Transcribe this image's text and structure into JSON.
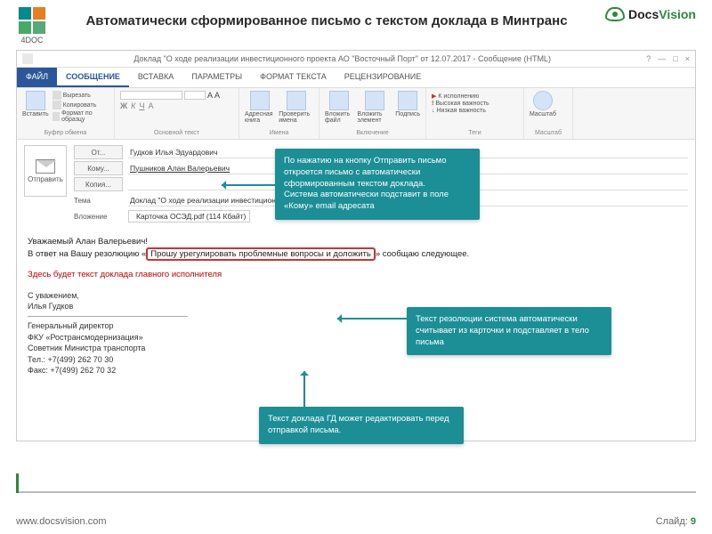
{
  "slide": {
    "title": "Автоматически сформированное письмо с текстом доклада в Минтранс",
    "logo4doc": "4DOC",
    "docsvision": "DocsVision",
    "footer_url": "www.docsvision.com",
    "footer_slide_label": "Слайд:",
    "footer_slide_num": "9"
  },
  "window": {
    "title": "Доклад \"О ходе реализации инвестиционного проекта АО \"Восточный Порт\" от 12.07.2017 - Сообщение (HTML)",
    "help": "?",
    "min": "—",
    "max": "□",
    "close": "×"
  },
  "tabs": {
    "file": "ФАЙЛ",
    "message": "СООБЩЕНИЕ",
    "insert": "ВСТАВКА",
    "options": "ПАРАМЕТРЫ",
    "format": "ФОРМАТ ТЕКСТА",
    "review": "РЕЦЕНЗИРОВАНИЕ"
  },
  "ribbon": {
    "paste": "Вставить",
    "cut": "Вырезать",
    "copy": "Копировать",
    "fmt": "Формат по образцу",
    "clipboard_group": "Буфер обмена",
    "font_group": "Основной текст",
    "addrbook": "Адресная книга",
    "check": "Проверить имена",
    "names_group": "Имена",
    "attach": "Вложить файл",
    "attach_item": "Вложить элемент",
    "signature": "Подпись",
    "include_group": "Включение",
    "followup": "К исполнению",
    "high": "Высокая важность",
    "low": "Низкая важность",
    "tags_group": "Теги",
    "zoom": "Масштаб",
    "zoom_group": "Масштаб"
  },
  "mail": {
    "send": "Отправить",
    "from_label": "От...",
    "from_value": "Гудков Илья Эдуардович",
    "to_label": "Кому...",
    "to_value": "Пушников Алан Валерьевич",
    "cc_label": "Копия...",
    "cc_value": "",
    "subject_label": "Тема",
    "subject_value": "Доклад \"О ходе реализации инвестиционного проекта АО \"Восточный Порт\" от 12.07.2017",
    "attach_label": "Вложение",
    "attach_value": "Карточка ОСЭД.pdf (114 Кбайт)"
  },
  "body": {
    "greeting": "Уважаемый Алан Валерьевич!",
    "line_pre": "В ответ на Вашу резолюцию «",
    "line_hl": "Прошу урегулировать проблемные вопросы и доложить",
    "line_post": "» сообщаю следующее.",
    "placeholder": "Здесь будет текст доклада главного исполнителя",
    "regards": "С уважением,",
    "sign_name": "Илья Гудков",
    "sign_title1": "Генеральный директор",
    "sign_title2": "ФКУ «Ространсмодернизация»",
    "sign_title3": "Советник Министра транспорта",
    "sign_tel": "Тел.: +7(499) 262 70 30",
    "sign_fax": "Факс: +7(499) 262 70 32"
  },
  "callouts": {
    "c1": "По нажатию на кнопку Отправить письмо откроется письмо с автоматически сформированным текстом доклада.\nСистема автоматически подставит в поле «Кому» email адресата",
    "c2": "Текст резолюции система автоматически считывает из карточки и подставляет в тело письма",
    "c3": "Текст доклада ГД может редактировать перед отправкой письма."
  }
}
